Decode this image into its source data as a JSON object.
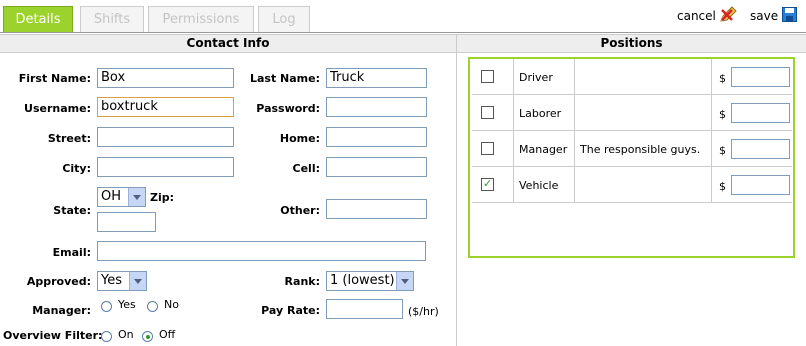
{
  "tabs": [
    {
      "label": "Details",
      "active": true
    },
    {
      "label": "Shifts",
      "active": false
    },
    {
      "label": "Permissions",
      "active": false
    },
    {
      "label": "Log",
      "active": false
    }
  ],
  "actions": {
    "cancel_label": "cancel",
    "save_label": "save",
    "cancel_icon": "cancel-pencil-icon",
    "save_icon": "floppy-disk-icon"
  },
  "contact": {
    "header": "Contact Info",
    "first_name": {
      "label": "First Name:",
      "value": "Box"
    },
    "last_name": {
      "label": "Last Name:",
      "value": "Truck"
    },
    "username": {
      "label": "Username:",
      "value": "boxtruck"
    },
    "password": {
      "label": "Password:",
      "value": ""
    },
    "street": {
      "label": "Street:",
      "value": ""
    },
    "home": {
      "label": "Home:",
      "value": ""
    },
    "city": {
      "label": "City:",
      "value": ""
    },
    "cell": {
      "label": "Cell:",
      "value": ""
    },
    "state": {
      "label": "State:",
      "value": "OH"
    },
    "zip": {
      "label": "Zip:",
      "value": ""
    },
    "other": {
      "label": "Other:",
      "value": ""
    },
    "email": {
      "label": "Email:",
      "value": ""
    },
    "approved": {
      "label": "Approved:",
      "value": "Yes"
    },
    "rank": {
      "label": "Rank:",
      "value": "1 (lowest)"
    },
    "manager": {
      "label": "Manager:",
      "yes": "Yes",
      "no": "No",
      "selected": "none"
    },
    "pay_rate": {
      "label": "Pay Rate:",
      "value": "",
      "unit": "($/hr)"
    },
    "overview_filter": {
      "label": "Overview Filter:",
      "on": "On",
      "off": "Off",
      "selected": "off"
    }
  },
  "positions": {
    "header": "Positions",
    "currency": "$",
    "rows": [
      {
        "name": "Driver",
        "description": "",
        "checked": false,
        "rate": ""
      },
      {
        "name": "Laborer",
        "description": "",
        "checked": false,
        "rate": ""
      },
      {
        "name": "Manager",
        "description": "The responsible guys.",
        "checked": false,
        "rate": ""
      },
      {
        "name": "Vehicle",
        "description": "",
        "checked": true,
        "rate": ""
      }
    ]
  },
  "colors": {
    "accent": "#9bd22c",
    "border": "#7f9db9"
  }
}
